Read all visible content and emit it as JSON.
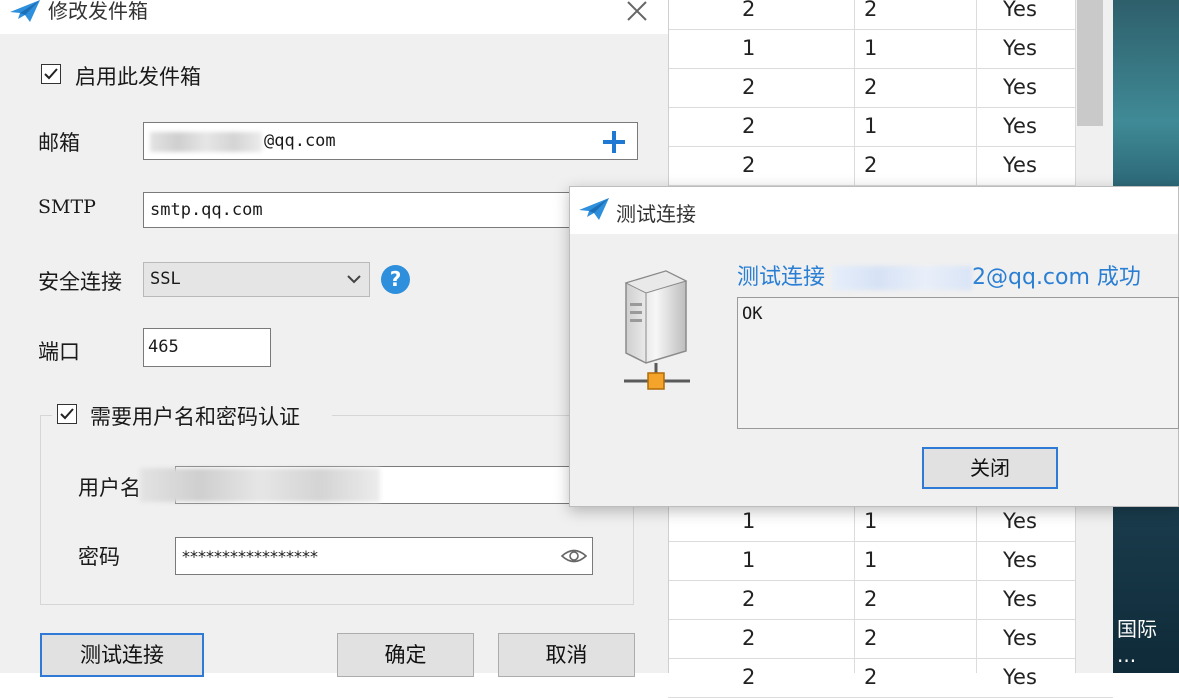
{
  "main_dialog": {
    "title": "修改发件箱",
    "enable_label": "启用此发件箱",
    "email_label": "邮箱",
    "email_value": "@qq.com",
    "smtp_label": "SMTP",
    "smtp_value": "smtp.qq.com",
    "security_label": "安全连接",
    "security_value": "SSL",
    "port_label": "端口",
    "port_value": "465",
    "auth_label": "需要用户名和密码认证",
    "username_label": "用户名",
    "password_label": "密码",
    "password_value": "*****************",
    "test_button": "测试连接",
    "ok_button": "确定",
    "cancel_button": "取消"
  },
  "test_dialog": {
    "title": "测试连接",
    "message_prefix": "测试连接",
    "message_suffix": "2@qq.com 成功",
    "output": "OK",
    "close_button": "关闭"
  },
  "spreadsheet": {
    "rows_top": [
      [
        "2",
        "2",
        "Yes"
      ],
      [
        "1",
        "1",
        "Yes"
      ],
      [
        "2",
        "2",
        "Yes"
      ],
      [
        "2",
        "1",
        "Yes"
      ],
      [
        "2",
        "2",
        "Yes"
      ]
    ],
    "rows_bottom": [
      [
        "1",
        "1",
        "Yes"
      ],
      [
        "1",
        "1",
        "Yes"
      ],
      [
        "2",
        "2",
        "Yes"
      ],
      [
        "2",
        "2",
        "Yes"
      ],
      [
        "2",
        "2",
        "Yes"
      ]
    ]
  },
  "background_text": {
    "line1": "国际",
    "line2": "..."
  },
  "colors": {
    "accent_blue": "#2a7fd4",
    "help_icon": "#2e8fdc",
    "add_icon": "#1f78d1"
  }
}
